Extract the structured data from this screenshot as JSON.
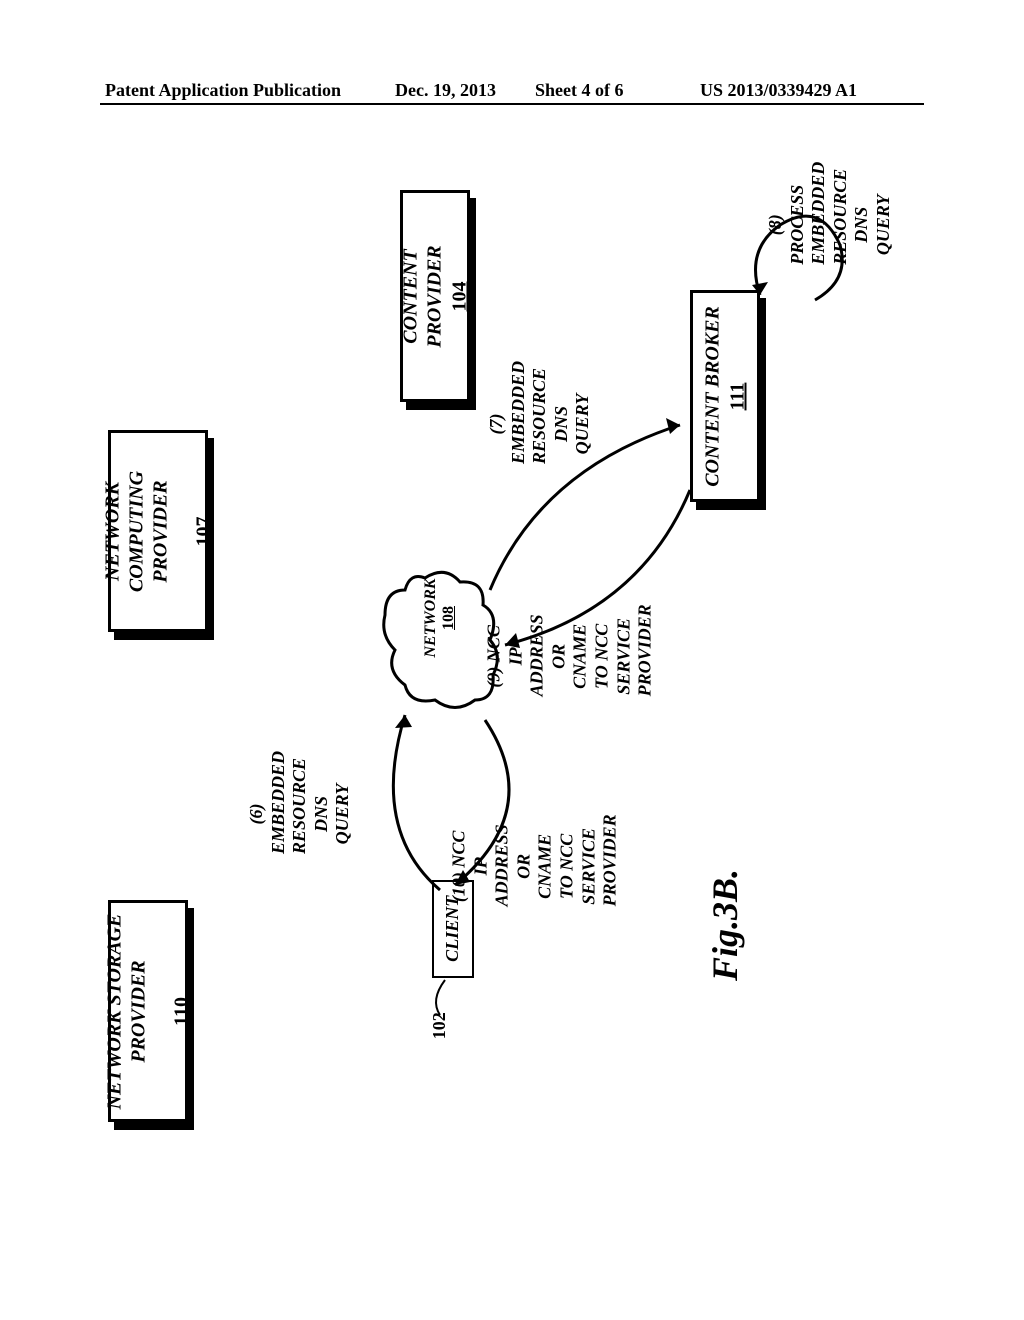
{
  "header": {
    "pub_type": "Patent Application Publication",
    "date": "Dec. 19, 2013",
    "sheet": "Sheet 4 of 6",
    "pub_number": "US 2013/0339429 A1"
  },
  "boxes": {
    "content_provider": {
      "label": "CONTENT PROVIDER",
      "ref": "104"
    },
    "network_computing_provider": {
      "label": "NETWORK\nCOMPUTING\nPROVIDER",
      "ref": "107"
    },
    "network_storage_provider": {
      "label": "NETWORK STORAGE\nPROVIDER",
      "ref": "110"
    },
    "content_broker": {
      "label": "CONTENT BROKER",
      "ref": "111"
    },
    "client": {
      "label": "CLIENT",
      "ref": "102"
    },
    "network": {
      "label": "NETWORK",
      "ref": "108"
    }
  },
  "flows": {
    "step6": "(6) EMBEDDED\nRESOURCE\nDNS QUERY",
    "step7": "(7) EMBEDDED RESOURCE\nDNS QUERY",
    "step8": "(8) PROCESS\nEMBEDDED RESOURCE\nDNS QUERY",
    "step9": "(9) NCC IP ADDRESS\nOR CNAME TO NCC\nSERVICE PROVIDER",
    "step10": "(10) NCC IP ADDRESS\nOR CNAME TO NCC\nSERVICE PROVIDER"
  },
  "figure_label": "Fig.3B."
}
